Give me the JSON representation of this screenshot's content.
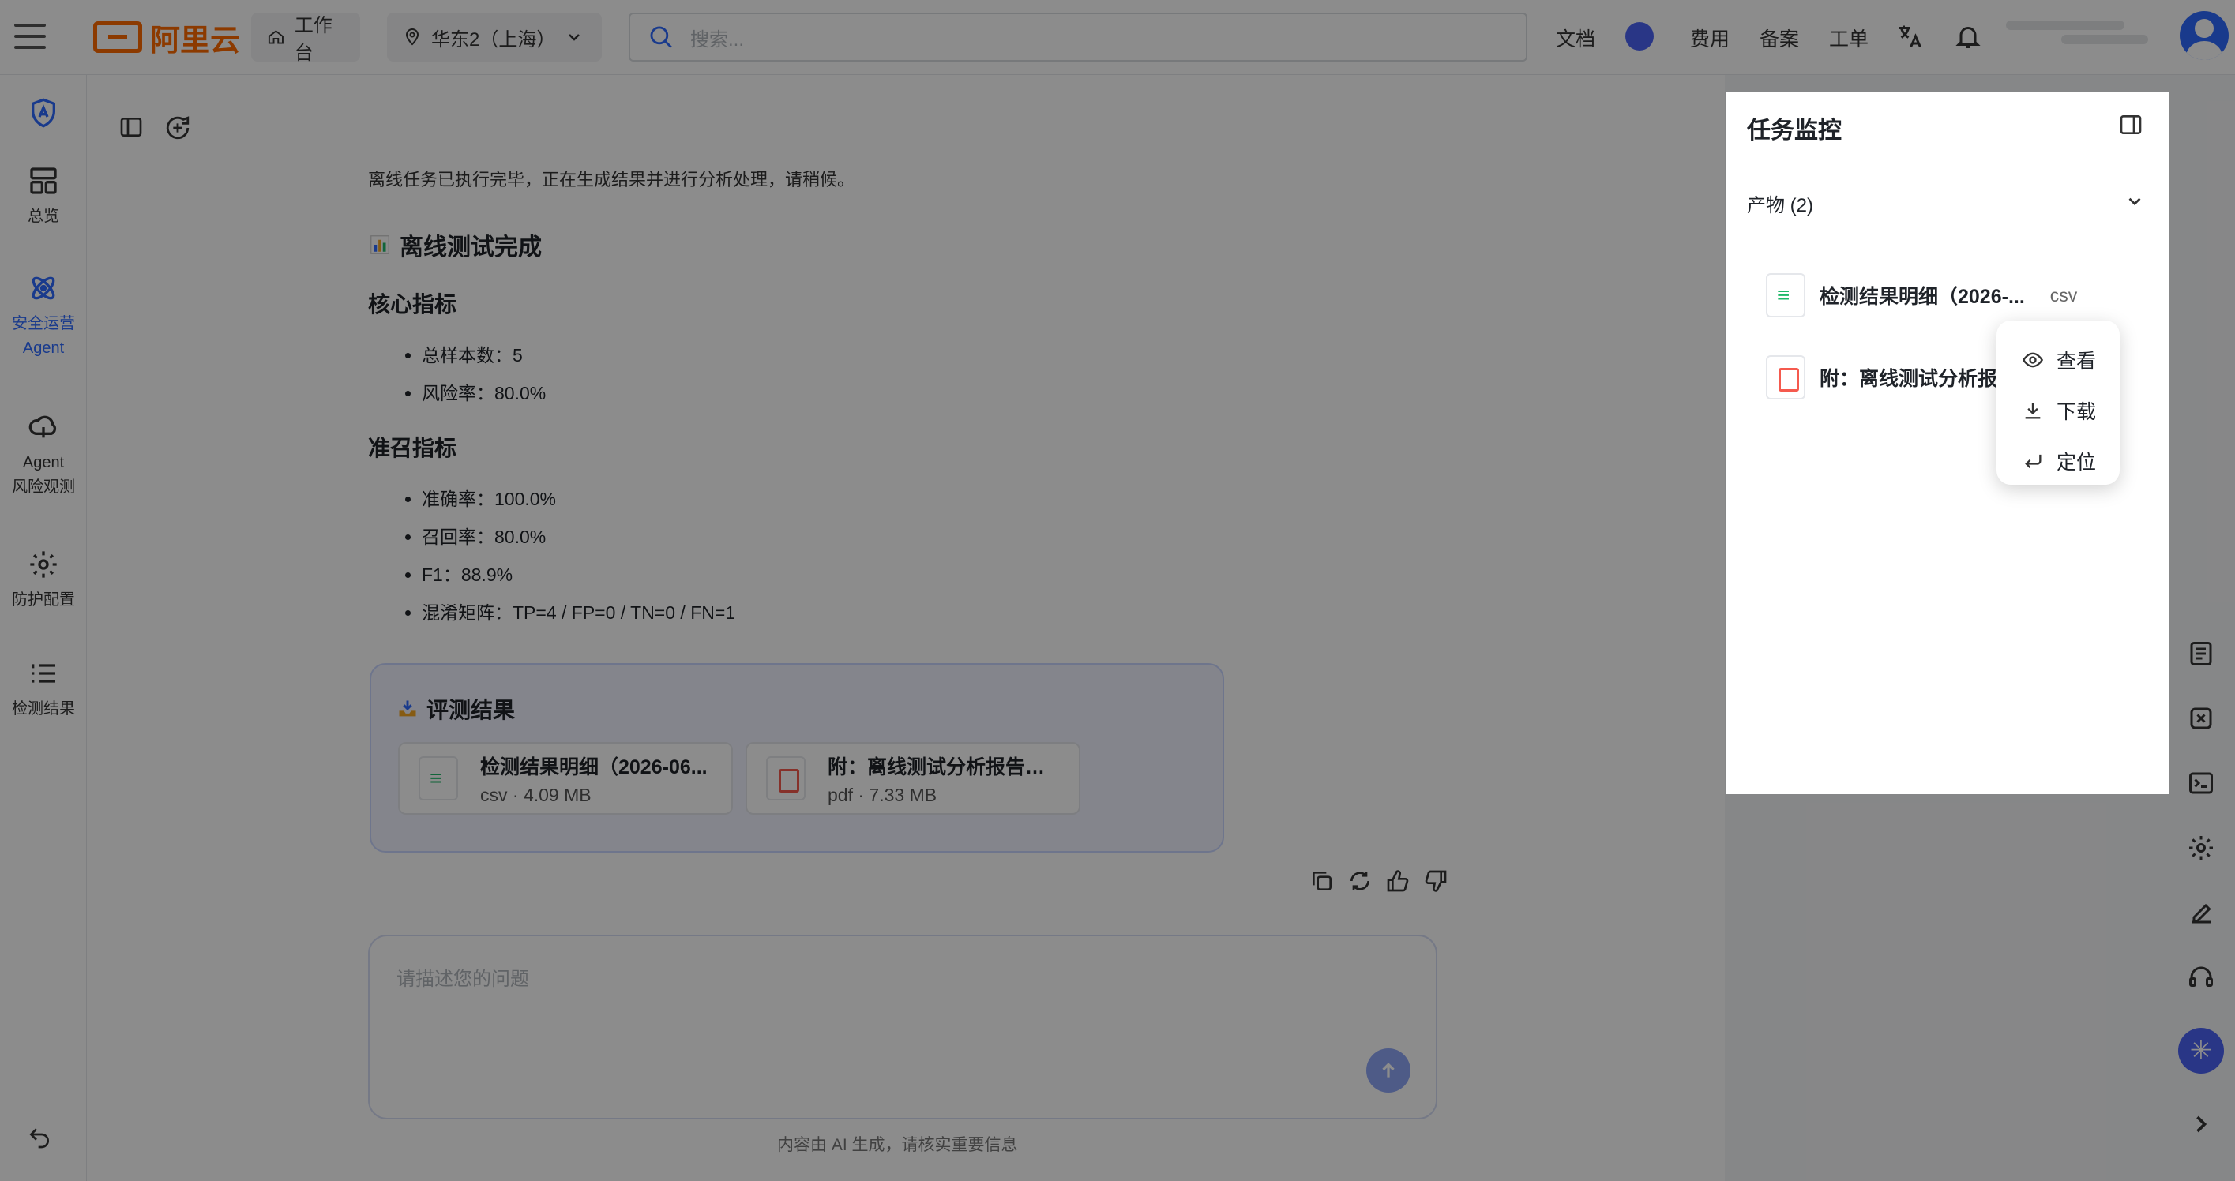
{
  "header": {
    "brand": "阿里云",
    "workbench": "工作台",
    "region": "华东2（上海）",
    "search_placeholder": "搜索...",
    "links": [
      "文档",
      "费用",
      "备案",
      "工单"
    ]
  },
  "rail": {
    "items": [
      {
        "label": "总览"
      },
      {
        "label": "安全运营\nAgent"
      },
      {
        "label": "Agent\n风险观测"
      },
      {
        "label": "防护配置"
      },
      {
        "label": "检测结果"
      }
    ]
  },
  "chat": {
    "note": "离线任务已执行完毕，正在生成结果并进行分析处理，请稍候。",
    "title": "离线测试完成",
    "core_heading": "核心指标",
    "core_metrics": [
      "总样本数：5",
      "风险率：80.0%"
    ],
    "recall_heading": "准召指标",
    "recall_metrics": [
      "准确率：100.0%",
      "召回率：80.0%",
      "F1：88.9%",
      "混淆矩阵：TP=4 / FP=0 / TN=0 / FN=1"
    ],
    "eval_title": "评测结果",
    "files": [
      {
        "name": "检测结果明细（2026-06...",
        "meta": "csv · 4.09 MB"
      },
      {
        "name": "附：离线测试分析报告（2...",
        "meta": "pdf · 7.33 MB"
      }
    ]
  },
  "composer": {
    "placeholder": "请描述您的问题",
    "disclaimer": "内容由 AI 生成，请核实重要信息"
  },
  "panel": {
    "title": "任务监控",
    "section": "产物 (2)",
    "artifacts": [
      {
        "name": "检测结果明细（2026-...",
        "ext": "csv"
      },
      {
        "name": "附：离线测试分析报告",
        "ext": ""
      }
    ]
  },
  "context_menu": {
    "items": [
      "查看",
      "下载",
      "定位"
    ]
  },
  "colors": {
    "brand": "#ff6a00",
    "accent": "#2f6bff"
  }
}
